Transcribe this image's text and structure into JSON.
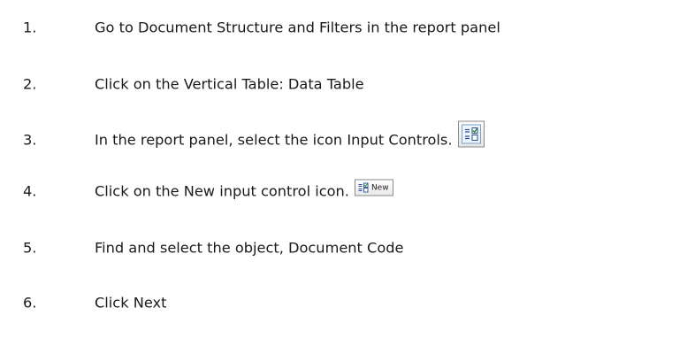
{
  "steps": [
    {
      "number": "1.",
      "text": "Go to Document Structure and Filters in the report panel"
    },
    {
      "number": "2.",
      "text": "Click on the Vertical Table: Data Table"
    },
    {
      "number": "3.",
      "text": "In the report panel, select the icon Input Controls.",
      "icon": "input-controls-icon"
    },
    {
      "number": "4.",
      "text": "Click on the New input control icon.",
      "icon": "new-input-control-icon",
      "button_label": "New"
    },
    {
      "number": "5.",
      "text": "Find and select the object, Document Code"
    },
    {
      "number": "6.",
      "text": "Click Next"
    }
  ]
}
